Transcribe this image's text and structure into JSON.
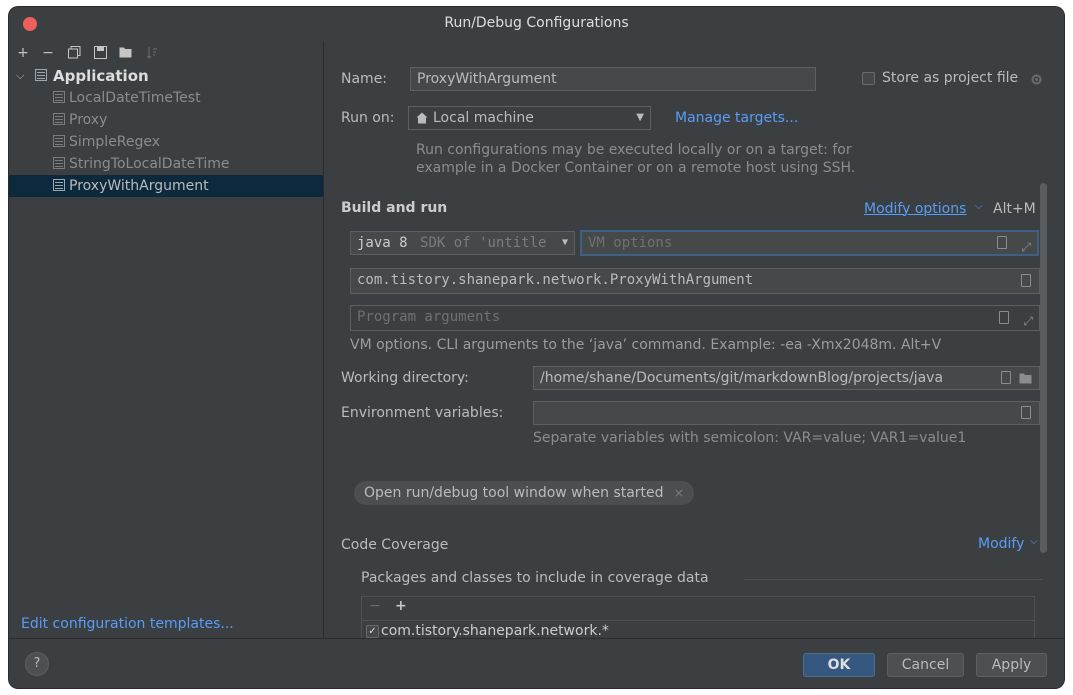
{
  "window": {
    "title": "Run/Debug Configurations"
  },
  "toolbar": {
    "add": "+",
    "remove": "−"
  },
  "tree": {
    "root": "Application",
    "children": [
      {
        "label": "LocalDateTimeTest"
      },
      {
        "label": "Proxy"
      },
      {
        "label": "SimpleRegex"
      },
      {
        "label": "StringToLocalDateTime"
      },
      {
        "label": "ProxyWithArgument",
        "selected": true
      }
    ]
  },
  "sidebar": {
    "edit_templates": "Edit configuration templates..."
  },
  "form": {
    "name_label": "Name:",
    "name_value": "ProxyWithArgument",
    "store_label": "Store as project file",
    "run_on_label": "Run on:",
    "run_on_value": "Local machine",
    "manage_targets": "Manage targets...",
    "run_on_hint_1": "Run configurations may be executed locally or on a target: for",
    "run_on_hint_2": "example in a Docker Container or on a remote host using SSH.",
    "build_and_run": "Build and run",
    "modify_options": "Modify options",
    "modify_shortcut": "Alt+M",
    "jdk_version": "java 8",
    "jdk_detail": "SDK of 'untitle",
    "vm_options_placeholder": "VM options",
    "main_class": "com.tistory.shanepark.network.ProxyWithArgument",
    "program_args_placeholder": "Program arguments",
    "vm_hint": "VM options. CLI arguments to the ‘java’ command. Example: -ea -Xmx2048m. Alt+V",
    "working_dir_label": "Working directory:",
    "working_dir_value": "/home/shane/Documents/git/markdownBlog/projects/java",
    "env_vars_label": "Environment variables:",
    "env_vars_value": "",
    "env_vars_hint": "Separate variables with semicolon: VAR=value; VAR1=value1",
    "open_tool_window_chip": "Open run/debug tool window when started",
    "chip_close": "×",
    "code_coverage": "Code Coverage",
    "modify": "Modify",
    "packages_label": "Packages and classes to include in coverage data",
    "table_remove": "−",
    "table_add": "+",
    "coverage_entry": "com.tistory.shanepark.network.*",
    "coverage_entry_checked": true
  },
  "footer": {
    "help": "?",
    "ok": "OK",
    "cancel": "Cancel",
    "apply": "Apply"
  },
  "colors": {
    "background": "#3c3f41",
    "accent": "#589df6",
    "selection": "#0d293e",
    "ok_button": "#365880"
  }
}
